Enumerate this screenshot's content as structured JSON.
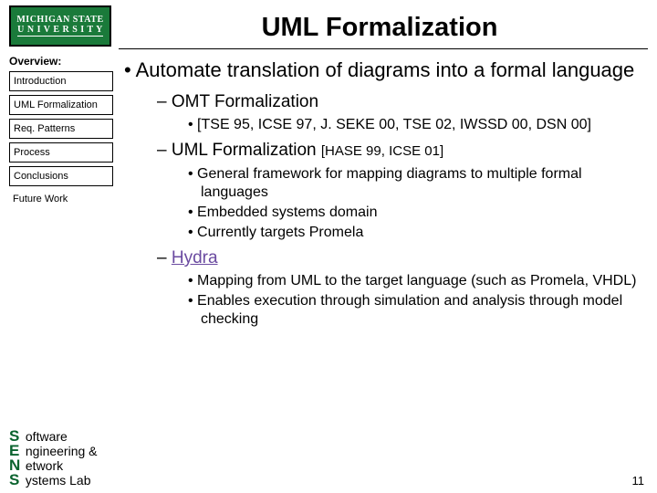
{
  "logo": {
    "line1": "MICHIGAN STATE",
    "line2": "U N I V E R S I T Y"
  },
  "title": "UML Formalization",
  "sidebar": {
    "heading": "Overview:",
    "items": [
      {
        "label": "Introduction"
      },
      {
        "label": "UML Formalization"
      },
      {
        "label": "Req. Patterns"
      },
      {
        "label": "Process"
      },
      {
        "label": "Conclusions"
      }
    ],
    "plain": {
      "label": "Future Work"
    }
  },
  "content": {
    "b1": "Automate translation of diagrams into a formal language",
    "sec1": {
      "title": "OMT Formalization",
      "refs": "[TSE 95, ICSE 97, J. SEKE 00, TSE 02, IWSSD 00, DSN 00]"
    },
    "sec2": {
      "title_main": "UML Formalization ",
      "title_refs": "[HASE 99, ICSE 01]",
      "p1": "General framework for mapping diagrams to multiple formal languages",
      "p2": "Embedded systems domain",
      "p3": "Currently targets Promela"
    },
    "sec3": {
      "title": "Hydra",
      "p1": "Mapping from UML to the target language (such as Promela, VHDL)",
      "p2": "Enables execution through simulation and analysis through model checking"
    }
  },
  "lab": {
    "l1a": "S",
    "l1b": " oftware",
    "l2a": "E",
    "l2b": " ngineering &",
    "l3a": "N",
    "l3b": " etwork",
    "l4a": "S",
    "l4b": " ystems Lab"
  },
  "pagenum": "11"
}
